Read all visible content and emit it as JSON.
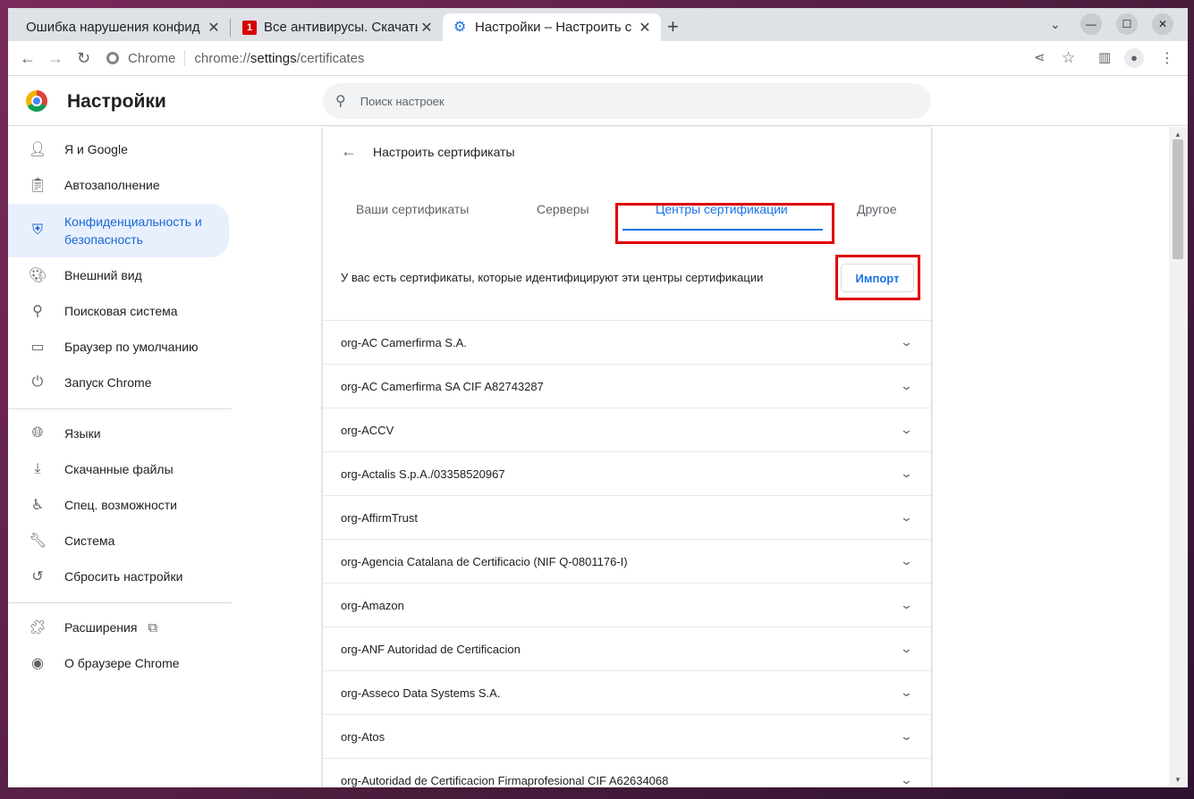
{
  "tabs": [
    {
      "title": "Ошибка нарушения конфид",
      "icon": "generic-page-icon"
    },
    {
      "title": "Все антивирусы. Скачать",
      "icon": "antivirus-site-icon"
    },
    {
      "title": "Настройки – Настроить с",
      "icon": "settings-gear-icon"
    }
  ],
  "toolbar": {
    "site_chip": "Chrome",
    "url_scheme": "chrome://",
    "url_host": "settings",
    "url_path": "/certificates"
  },
  "header": {
    "title": "Настройки",
    "search_placeholder": "Поиск настроек"
  },
  "sidebar": {
    "items": [
      {
        "label": "Я и Google",
        "icon": "person-icon"
      },
      {
        "label": "Автозаполнение",
        "icon": "clipboard-icon"
      },
      {
        "label": "Конфиденциальность и безопасность",
        "icon": "shield-icon",
        "selected": true
      },
      {
        "label": "Внешний вид",
        "icon": "palette-icon"
      },
      {
        "label": "Поисковая система",
        "icon": "search-icon"
      },
      {
        "label": "Браузер по умолчанию",
        "icon": "browser-window-icon"
      },
      {
        "label": "Запуск Chrome",
        "icon": "power-icon"
      },
      {
        "label": "Языки",
        "icon": "globe-icon"
      },
      {
        "label": "Скачанные файлы",
        "icon": "download-icon"
      },
      {
        "label": "Спец. возможности",
        "icon": "accessibility-icon"
      },
      {
        "label": "Система",
        "icon": "wrench-icon"
      },
      {
        "label": "Сбросить настройки",
        "icon": "restore-icon"
      },
      {
        "label": "Расширения",
        "icon": "puzzle-icon"
      },
      {
        "label": "О браузере Chrome",
        "icon": "chrome-icon"
      }
    ]
  },
  "main": {
    "subpage_title": "Настроить сертификаты",
    "tabs": [
      {
        "label": "Ваши сертификаты"
      },
      {
        "label": "Серверы"
      },
      {
        "label": "Центры сертификации",
        "active": true
      },
      {
        "label": "Другое"
      }
    ],
    "info_text": "У вас есть сертификаты, которые идентифицируют эти центры сертификации",
    "import_label": "Импорт",
    "certificates": [
      "org-AC Camerfirma S.A.",
      "org-AC Camerfirma SA CIF A82743287",
      "org-ACCV",
      "org-Actalis S.p.A./03358520967",
      "org-AffirmTrust",
      "org-Agencia Catalana de Certificacio (NIF Q-0801176-I)",
      "org-Amazon",
      "org-ANF Autoridad de Certificacion",
      "org-Asseco Data Systems S.A.",
      "org-Atos",
      "org-Autoridad de Certificacion Firmaprofesional CIF A62634068"
    ]
  },
  "colors": {
    "accent": "#1a73e8",
    "selected_bg": "#e8f0fe",
    "highlight_box": "#e00000"
  }
}
